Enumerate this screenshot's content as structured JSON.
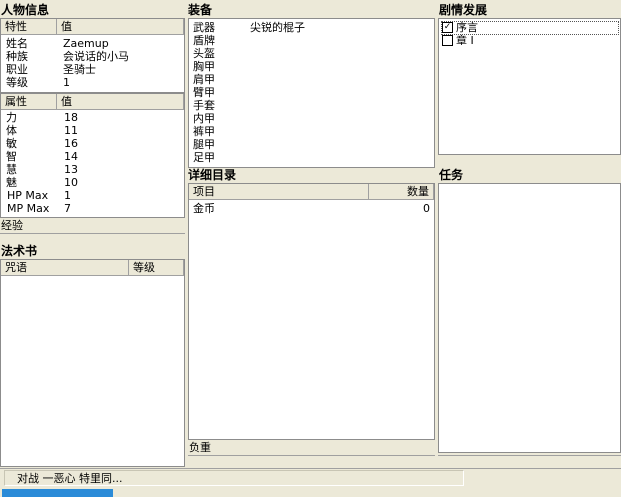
{
  "character": {
    "title": "人物信息",
    "info_headers": [
      "特性",
      "值"
    ],
    "info": [
      {
        "k": "姓名",
        "v": "Zaemup"
      },
      {
        "k": "种族",
        "v": "会说话的小马"
      },
      {
        "k": "职业",
        "v": "圣骑士"
      },
      {
        "k": "等级",
        "v": "1"
      }
    ],
    "stat_headers": [
      "属性",
      "值"
    ],
    "stats": [
      {
        "k": "力",
        "v": "18"
      },
      {
        "k": "体",
        "v": "11"
      },
      {
        "k": "敏",
        "v": "16"
      },
      {
        "k": "智",
        "v": "14"
      },
      {
        "k": "慧",
        "v": "13"
      },
      {
        "k": "魅",
        "v": "10"
      },
      {
        "k": "HP Max",
        "v": "1"
      },
      {
        "k": "MP Max",
        "v": "7"
      }
    ],
    "exp_label": "经验"
  },
  "spellbook": {
    "title": "法术书",
    "headers": [
      "咒语",
      "等级"
    ]
  },
  "equipment": {
    "title": "装备",
    "slots": [
      {
        "slot": "武器",
        "item": "尖锐的棍子"
      },
      {
        "slot": "盾牌",
        "item": ""
      },
      {
        "slot": "头盔",
        "item": ""
      },
      {
        "slot": "胸甲",
        "item": ""
      },
      {
        "slot": "肩甲",
        "item": ""
      },
      {
        "slot": "臂甲",
        "item": ""
      },
      {
        "slot": "手套",
        "item": ""
      },
      {
        "slot": "内甲",
        "item": ""
      },
      {
        "slot": "裤甲",
        "item": ""
      },
      {
        "slot": "腿甲",
        "item": ""
      },
      {
        "slot": "足甲",
        "item": ""
      }
    ]
  },
  "inventory": {
    "title": "详细目录",
    "headers": [
      "项目",
      "数量"
    ],
    "rows": [
      {
        "item": "金币",
        "qty": "0"
      }
    ],
    "weight_label": "负重"
  },
  "plot": {
    "title": "剧情发展",
    "items": [
      {
        "label": "序言",
        "checked": true
      },
      {
        "label": "章 I",
        "checked": false
      }
    ]
  },
  "quests": {
    "title": "任务"
  },
  "status": {
    "text": "对战  一恶心 特里同...",
    "progress": 0.18
  }
}
